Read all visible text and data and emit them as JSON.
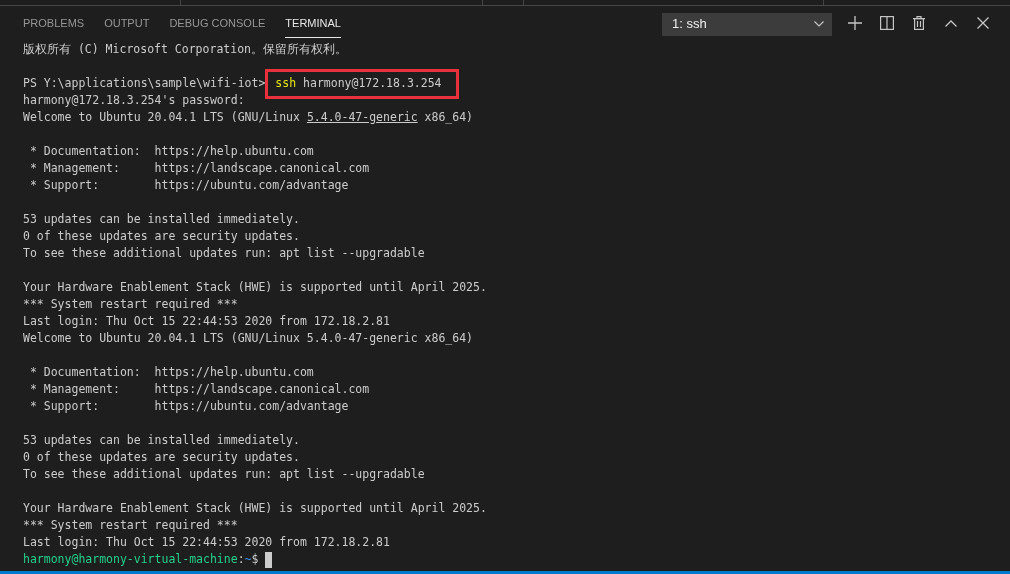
{
  "panel_tabs": [
    {
      "label": "PROBLEMS",
      "selected": false
    },
    {
      "label": "OUTPUT",
      "selected": false
    },
    {
      "label": "DEBUG CONSOLE",
      "selected": false
    },
    {
      "label": "TERMINAL",
      "selected": true
    }
  ],
  "terminal_select": {
    "value": "1: ssh"
  },
  "terminal": {
    "lines": [
      {
        "kind": "text",
        "text": "版权所有 (C) Microsoft Corporation。保留所有权利。"
      },
      {
        "kind": "blank"
      },
      {
        "kind": "command",
        "prompt": "PS Y:\\applications\\sample\\wifi-iot>",
        "program": "ssh",
        "args": "harmony@172.18.3.254",
        "highlighted": true
      },
      {
        "kind": "text",
        "text": "harmony@172.18.3.254's password:"
      },
      {
        "kind": "text_with_link",
        "before": "Welcome to Ubuntu 20.04.1 LTS (GNU/Linux ",
        "link": "5.4.0-47-generic",
        "after": " x86_64)"
      },
      {
        "kind": "blank"
      },
      {
        "kind": "text",
        "text": " * Documentation:  https://help.ubuntu.com"
      },
      {
        "kind": "text",
        "text": " * Management:     https://landscape.canonical.com"
      },
      {
        "kind": "text",
        "text": " * Support:        https://ubuntu.com/advantage"
      },
      {
        "kind": "blank"
      },
      {
        "kind": "text",
        "text": "53 updates can be installed immediately."
      },
      {
        "kind": "text",
        "text": "0 of these updates are security updates."
      },
      {
        "kind": "text",
        "text": "To see these additional updates run: apt list --upgradable"
      },
      {
        "kind": "blank"
      },
      {
        "kind": "text",
        "text": "Your Hardware Enablement Stack (HWE) is supported until April 2025."
      },
      {
        "kind": "text",
        "text": "*** System restart required ***"
      },
      {
        "kind": "text",
        "text": "Last login: Thu Oct 15 22:44:53 2020 from 172.18.2.81"
      },
      {
        "kind": "text",
        "text": "Welcome to Ubuntu 20.04.1 LTS (GNU/Linux 5.4.0-47-generic x86_64)"
      },
      {
        "kind": "blank"
      },
      {
        "kind": "text",
        "text": " * Documentation:  https://help.ubuntu.com"
      },
      {
        "kind": "text",
        "text": " * Management:     https://landscape.canonical.com"
      },
      {
        "kind": "text",
        "text": " * Support:        https://ubuntu.com/advantage"
      },
      {
        "kind": "blank"
      },
      {
        "kind": "text",
        "text": "53 updates can be installed immediately."
      },
      {
        "kind": "text",
        "text": "0 of these updates are security updates."
      },
      {
        "kind": "text",
        "text": "To see these additional updates run: apt list --upgradable"
      },
      {
        "kind": "blank"
      },
      {
        "kind": "text",
        "text": "Your Hardware Enablement Stack (HWE) is supported until April 2025."
      },
      {
        "kind": "text",
        "text": "*** System restart required ***"
      },
      {
        "kind": "text",
        "text": "Last login: Thu Oct 15 22:44:53 2020 from 172.18.2.81"
      },
      {
        "kind": "prompt",
        "user": "harmony@harmony-virtual-machine",
        "separator": ":",
        "path": "~",
        "symbol": "$",
        "cursor": true
      }
    ]
  }
}
